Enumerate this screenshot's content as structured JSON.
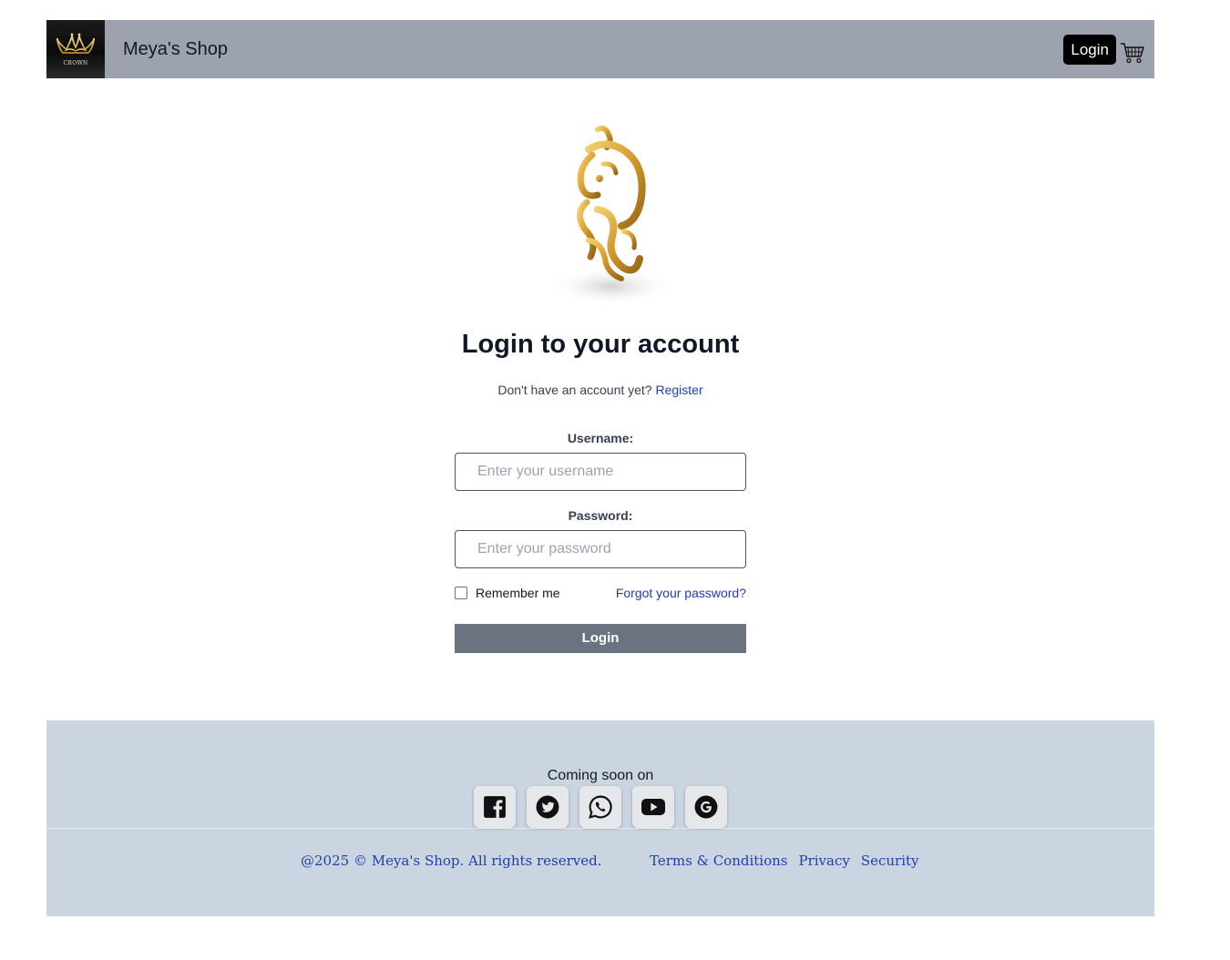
{
  "header": {
    "logo_text": "CROWN",
    "shop_name": "Meya's Shop",
    "login_label": "Login",
    "cart_icon": "cart-icon"
  },
  "main": {
    "hero_image": "ganesha-gold-image",
    "title": "Login to your account",
    "signup_prompt": "Don't have an account yet?",
    "register_link": "Register",
    "username_label": "Username:",
    "username_placeholder": "Enter your username",
    "password_label": "Password:",
    "password_placeholder": "Enter your password",
    "remember_label": "Remember me",
    "remember_checked": false,
    "forgot_link": "Forgot your password?",
    "submit_label": "Login"
  },
  "footer": {
    "coming_soon": "Coming soon on",
    "socials": [
      "facebook-icon",
      "twitter-icon",
      "whatsapp-icon",
      "youtube-icon",
      "google-icon"
    ],
    "copyright": "@2025 © Meya's Shop. All rights reserved.",
    "links": [
      "Terms & Conditions",
      "Privacy",
      "Security"
    ]
  },
  "colors": {
    "header_bg": "#9ca3af",
    "footer_bg": "#cbd5e1",
    "link": "#1e40af",
    "submit_bg": "#6b7280",
    "login_nav_bg": "#000000"
  }
}
